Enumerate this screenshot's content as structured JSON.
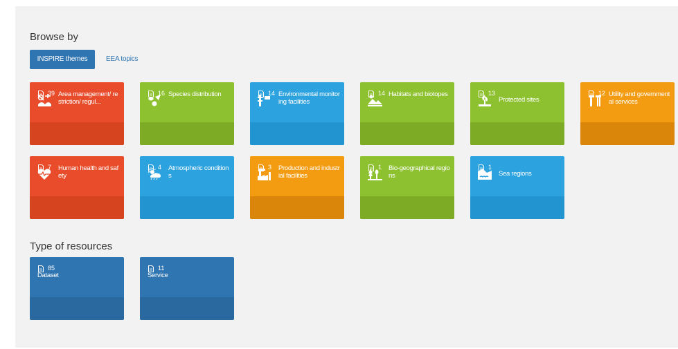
{
  "browse": {
    "title": "Browse by",
    "tabs": {
      "active": "INSPIRE themes",
      "other": "EEA topics"
    }
  },
  "themes": [
    {
      "label": "Area management/ restriction/ regul...",
      "count": "39",
      "color": "red",
      "icon": "area-management-icon"
    },
    {
      "label": "Species distribution",
      "count": "16",
      "color": "green",
      "icon": "species-icon"
    },
    {
      "label": "Environmental monitoring facilities",
      "count": "14",
      "color": "blue",
      "icon": "monitoring-icon"
    },
    {
      "label": "Habitats and biotopes",
      "count": "14",
      "color": "green",
      "icon": "habitats-icon"
    },
    {
      "label": "Protected sites",
      "count": "13",
      "color": "green",
      "icon": "protected-sites-icon"
    },
    {
      "label": "Utility and governmental services",
      "count": "12",
      "color": "orange",
      "icon": "utility-icon"
    },
    {
      "label": "Human health and safety",
      "count": "7",
      "color": "red",
      "icon": "health-icon"
    },
    {
      "label": "Atmospheric conditions",
      "count": "4",
      "color": "blue",
      "icon": "atmospheric-icon"
    },
    {
      "label": "Production and industrial facilities",
      "count": "3",
      "color": "orange",
      "icon": "industry-icon"
    },
    {
      "label": "Bio-geographical regions",
      "count": "1",
      "color": "green",
      "icon": "biogeo-icon"
    },
    {
      "label": "Sea regions",
      "count": "1",
      "color": "blue",
      "icon": "sea-icon"
    }
  ],
  "resources": {
    "title": "Type of resources",
    "items": [
      {
        "label": "Dataset",
        "count": "85"
      },
      {
        "label": "Service",
        "count": "11"
      }
    ]
  },
  "colors": {
    "red": "#e84c2b",
    "green": "#8dc130",
    "blue": "#2ca2de",
    "orange": "#f39c12",
    "navy": "#2f75b1"
  }
}
